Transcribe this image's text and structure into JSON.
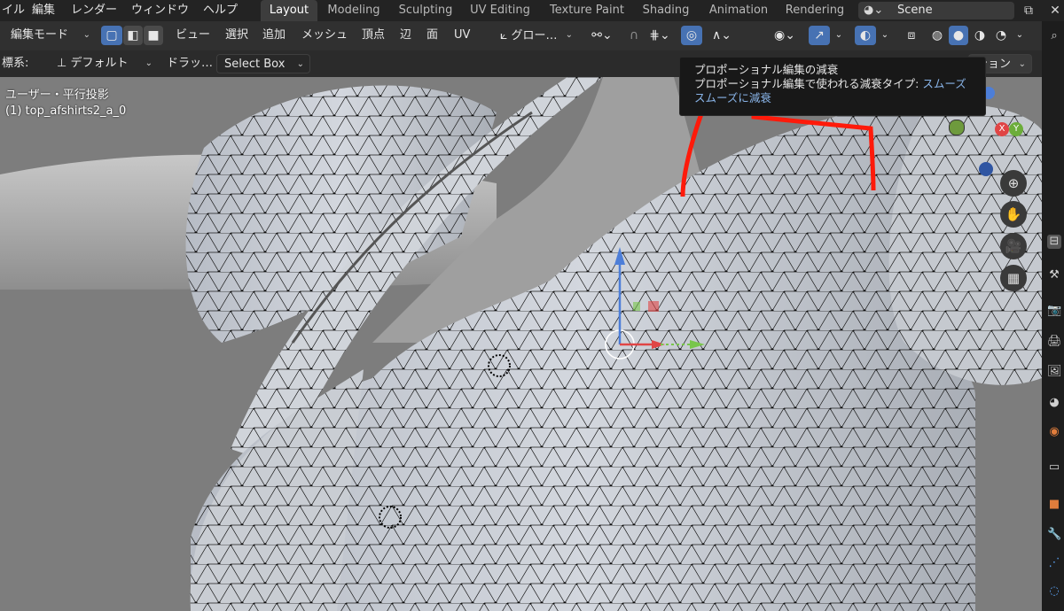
{
  "menubar": {
    "items": [
      "イル",
      "編集",
      "レンダー",
      "ウィンドウ",
      "ヘルプ"
    ],
    "workspaces": [
      "Layout",
      "Modeling",
      "Sculpting",
      "UV Editing",
      "Texture Paint",
      "Shading",
      "Animation",
      "Rendering"
    ],
    "scene_label": "Scene"
  },
  "header": {
    "mode": "編集モード",
    "menus": [
      "ビュー",
      "選択",
      "追加",
      "メッシュ",
      "頂点",
      "辺",
      "面",
      "UV"
    ],
    "pivot": "グロー…"
  },
  "toolrow": {
    "coord_label": "標系:",
    "orientation": "デフォルト",
    "drag_label": "ドラッ…",
    "select_box": "Select Box",
    "option_label": "ション"
  },
  "viewport": {
    "view_name": "ユーザー・平行投影",
    "object_name": "(1) top_afshirts2_a_0",
    "gizmo_x": "X",
    "gizmo_y": "Y"
  },
  "tooltip": {
    "title": "プロポーショナル編集の減衰",
    "line2_prefix": "プロポーショナル編集で使われる減衰タイプ: ",
    "line2_value": "スムーズ",
    "line3": "スムーズに減衰"
  },
  "colors": {
    "accent_blue": "#4772b3",
    "annotation_red": "#ff1a0a",
    "menubar_bg": "#232323"
  }
}
